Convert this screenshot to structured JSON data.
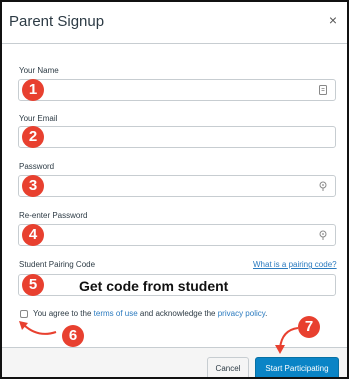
{
  "modal": {
    "title": "Parent Signup",
    "close_icon": "close-icon",
    "close_glyph": "×"
  },
  "fields": {
    "name": {
      "label": "Your Name",
      "value": "",
      "icon": "contact-card-icon"
    },
    "email": {
      "label": "Your Email",
      "value": ""
    },
    "password": {
      "label": "Password",
      "value": "",
      "icon": "key-icon"
    },
    "reenter_password": {
      "label": "Re-enter Password",
      "value": "",
      "icon": "key-icon"
    },
    "pairing_code": {
      "label": "Student Pairing Code",
      "help_link": "What is a pairing code?",
      "annotation": "Get code from student"
    }
  },
  "agreement": {
    "prefix": "You agree to the ",
    "terms_link": "terms of use",
    "middle": " and acknowledge the ",
    "privacy_link": "privacy policy",
    "suffix": ".",
    "checked": false
  },
  "buttons": {
    "cancel": "Cancel",
    "start": "Start Participating"
  },
  "annotations": {
    "badges": [
      "1",
      "2",
      "3",
      "4",
      "5",
      "6",
      "7"
    ],
    "color": "#e8402f"
  },
  "colors": {
    "primary_button": "#0a84c6",
    "link": "#2a7abf"
  }
}
